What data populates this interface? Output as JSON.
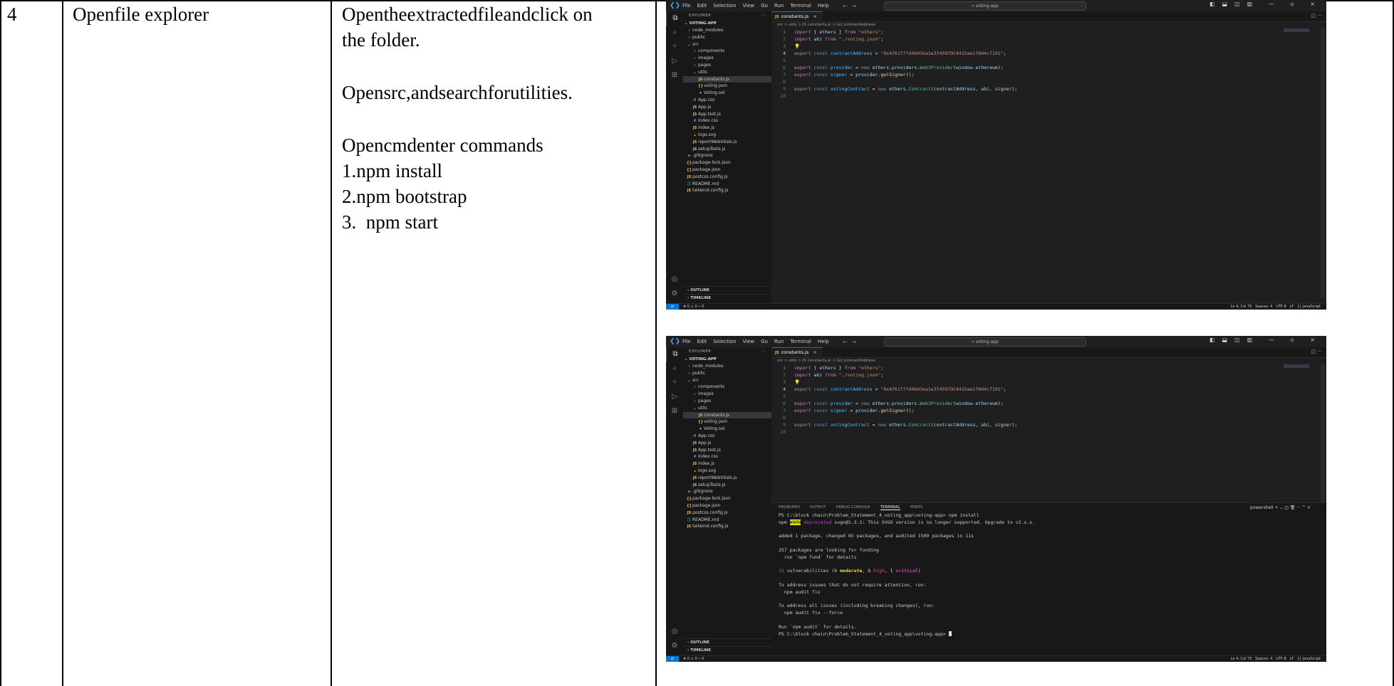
{
  "row": {
    "number": "4",
    "title": "Openfile explorer",
    "instructions": {
      "line1": "Opentheextractedfileandclick on",
      "line2": "the folder.",
      "line3": "Opensrc,andsearchforutilities.",
      "line4": "Opencmdenter commands",
      "steps": [
        "1.npm install",
        "2.npm bootstrap",
        "3.  npm start"
      ]
    }
  },
  "vscode": {
    "logo_icon": "vscode-logo-icon",
    "menu": [
      "File",
      "Edit",
      "Selection",
      "View",
      "Go",
      "Run",
      "Terminal",
      "Help"
    ],
    "search_text": "voting-app",
    "explorer_title": "EXPLORER",
    "explorer_more": "···",
    "project_name": "VOTING-APP",
    "tree": [
      {
        "label": "node_modules",
        "type": "folder",
        "depth": 1
      },
      {
        "label": "public",
        "type": "folder",
        "depth": 1
      },
      {
        "label": "src",
        "type": "folder-open",
        "depth": 1
      },
      {
        "label": "components",
        "type": "folder",
        "depth": 2
      },
      {
        "label": "images",
        "type": "folder",
        "depth": 2
      },
      {
        "label": "pages",
        "type": "folder",
        "depth": 2
      },
      {
        "label": "utils",
        "type": "folder-open",
        "depth": 2
      },
      {
        "label": "constants.js",
        "type": "js",
        "depth": 3,
        "selected": true
      },
      {
        "label": "voting.json",
        "type": "json",
        "depth": 3
      },
      {
        "label": "Voting.sol",
        "type": "sol",
        "depth": 3
      },
      {
        "label": "App.css",
        "type": "css",
        "depth": 2
      },
      {
        "label": "App.js",
        "type": "js",
        "depth": 2
      },
      {
        "label": "App.test.js",
        "type": "js",
        "depth": 2
      },
      {
        "label": "index.css",
        "type": "css",
        "depth": 2
      },
      {
        "label": "index.js",
        "type": "js",
        "depth": 2
      },
      {
        "label": "logo.svg",
        "type": "svg",
        "depth": 2
      },
      {
        "label": "reportWebVitals.js",
        "type": "js",
        "depth": 2
      },
      {
        "label": "setupTests.js",
        "type": "js",
        "depth": 2
      },
      {
        "label": ".gitignore",
        "type": "git",
        "depth": 1
      },
      {
        "label": "package-lock.json",
        "type": "json",
        "depth": 1
      },
      {
        "label": "package.json",
        "type": "json",
        "depth": 1
      },
      {
        "label": "postcss.config.js",
        "type": "js",
        "depth": 1
      },
      {
        "label": "README.md",
        "type": "md",
        "depth": 1
      },
      {
        "label": "tailwind.config.js",
        "type": "js",
        "depth": 1
      }
    ],
    "outline_label": "OUTLINE",
    "timeline_label": "TIMELINE",
    "tab_label": "constants.js",
    "tab_badge": "JS",
    "tab_close": "×",
    "breadcrumb": "src > utils > JS constants.js > [e] contractAddress",
    "code_lines": [
      {
        "n": "1",
        "html": "<span class=\"kw2\">import</span> <span class=\"txt\">{ </span><span class=\"id\">ethers</span><span class=\"txt\"> } </span><span class=\"kw2\">from</span> <span class=\"str\">\"ethers\"</span><span class=\"txt\">;</span>"
      },
      {
        "n": "2",
        "html": "<span class=\"kw2\">import</span> <span class=\"id\">abi</span> <span class=\"kw2\">from</span> <span class=\"str\">\"./voting.json\"</span><span class=\"txt\">;</span>"
      },
      {
        "n": "3",
        "html": "<span class=\"fn\">💡</span>"
      },
      {
        "n": "4",
        "html": "<span class=\"kw2\">export</span> <span class=\"kw\">const</span> <span class=\"var\">contractAddress</span> <span class=\"txt\">= </span><span class=\"str\">\"0xAf61f7fd4b03ea1e3f459fDC4415ae1fA04c7191\"</span><span class=\"txt\">;</span>"
      },
      {
        "n": "5",
        "html": ""
      },
      {
        "n": "6",
        "html": "<span class=\"kw2\">export</span> <span class=\"kw\">const</span> <span class=\"var\">provider</span> <span class=\"txt\">= </span><span class=\"kw\">new</span> <span class=\"id\">ethers</span><span class=\"txt\">.</span><span class=\"id\">providers</span><span class=\"txt\">.</span><span class=\"cls\">Web3Provider</span><span class=\"txt\">(</span><span class=\"id\">window</span><span class=\"txt\">.</span><span class=\"id\">ethereum</span><span class=\"txt\">);</span>"
      },
      {
        "n": "7",
        "html": "<span class=\"kw2\">export</span> <span class=\"kw\">const</span> <span class=\"var\">signer</span> <span class=\"txt\">= </span><span class=\"id\">provider</span><span class=\"txt\">.</span><span class=\"fn\">getSigner</span><span class=\"txt\">();</span>"
      },
      {
        "n": "8",
        "html": ""
      },
      {
        "n": "9",
        "html": "<span class=\"kw2\">export</span> <span class=\"kw\">const</span> <span class=\"var\">votingContract</span> <span class=\"txt\">= </span><span class=\"kw\">new</span> <span class=\"id\">ethers</span><span class=\"txt\">.</span><span class=\"cls\">Contract</span><span class=\"txt\">(</span><span class=\"id\">contractAddress</span><span class=\"txt\">, </span><span class=\"id\">abi</span><span class=\"txt\">, </span><span class=\"id\">signer</span><span class=\"txt\">);</span>"
      },
      {
        "n": "10",
        "html": ""
      }
    ],
    "status_left": "⊗ 0 ⚠ 0   ⑂ 0",
    "status_right": "Ln 4, Col 75   Spaces: 4   UTF-8   LF   {} JavaScript",
    "panel_tabs": [
      "PROBLEMS",
      "OUTPUT",
      "DEBUG CONSOLE",
      "TERMINAL",
      "PORTS"
    ],
    "panel_active": "TERMINAL",
    "panel_right": "powershell  +  ⌄  ◫  🗑  ···  ^  ×",
    "terminal_lines": [
      {
        "html": "PS C:\\block chain\\Problem_Statement_4_voting_app\\voting-app&gt; npm install"
      },
      {
        "html": "npm <span class=\"warn\">WARN</span> <span class=\"depr\">deprecated</span> svgo@1.3.2: This SVGO version is no longer supported. Upgrade to v2.x.x."
      },
      {
        "html": ""
      },
      {
        "html": "added 1 package, changed 65 packages, and audited 1509 packages in 11s"
      },
      {
        "html": ""
      },
      {
        "html": "257 packages are looking for funding"
      },
      {
        "html": "  run `npm fund` for details"
      },
      {
        "html": ""
      },
      {
        "html": "<span class=\"red\">15</span> vulnerabilities (6 <span class=\"yel\">moderate</span>, 8 <span class=\"red\">high</span>, 1 <span class=\"mag\">critical</span>)"
      },
      {
        "html": ""
      },
      {
        "html": "To address issues that do not require attention, run:"
      },
      {
        "html": "  npm audit fix"
      },
      {
        "html": ""
      },
      {
        "html": "To address all issues (including breaking changes), run:"
      },
      {
        "html": "  npm audit fix --force"
      },
      {
        "html": ""
      },
      {
        "html": "Run `npm audit` for details."
      },
      {
        "html": "PS C:\\block chain\\Problem_Statement_4_voting_app\\voting-app&gt; <span class=\"cursor\"></span>"
      }
    ]
  }
}
